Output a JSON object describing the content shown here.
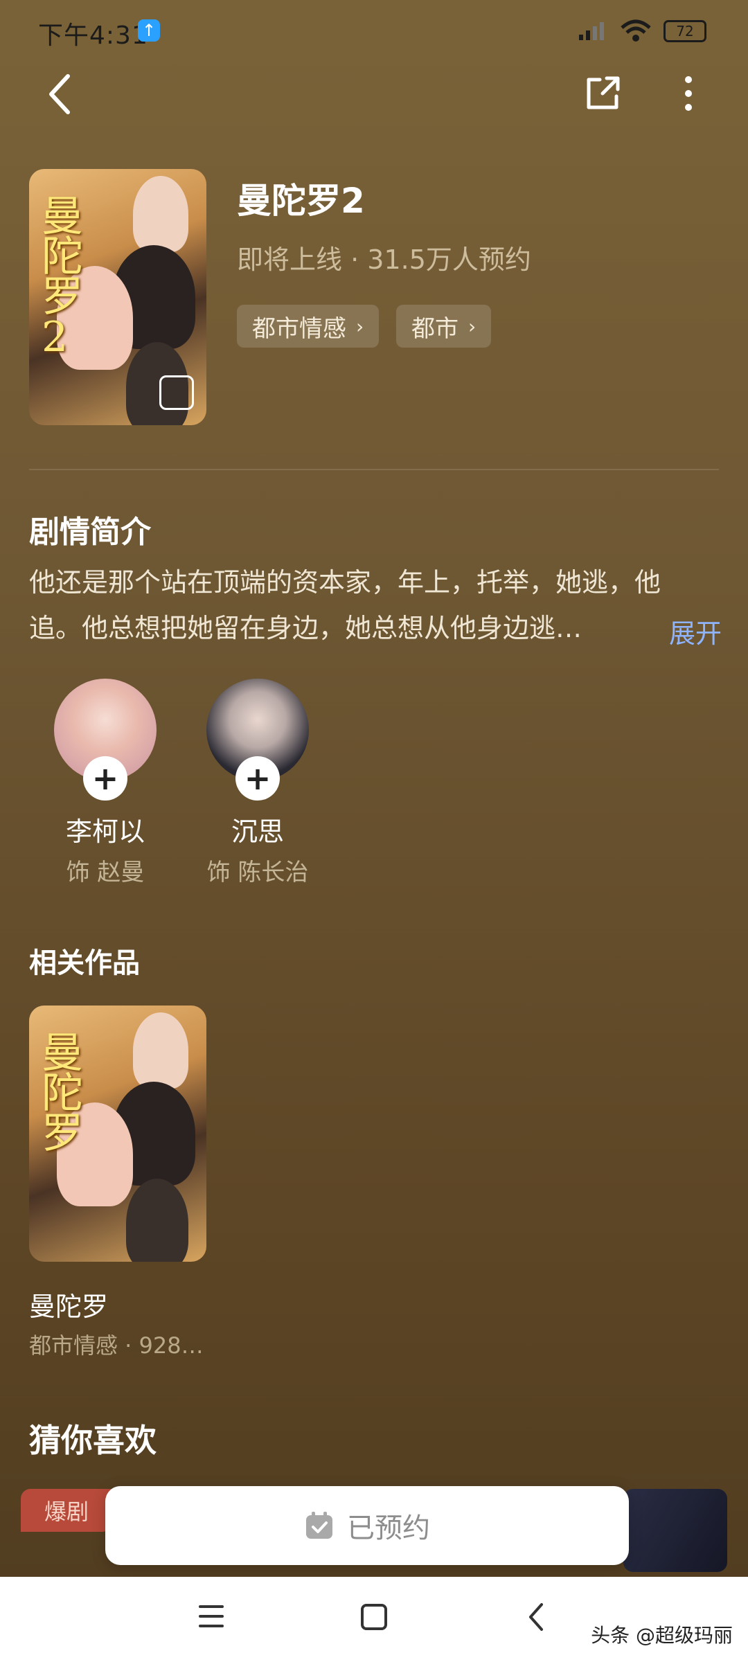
{
  "status_bar": {
    "time": "下午4:31",
    "battery": "72"
  },
  "drama": {
    "title": "曼陀罗2",
    "status": "即将上线",
    "separator": "·",
    "reservations": "31.5万人预约",
    "tags": [
      "都市情感",
      "都市"
    ],
    "cover_text": "曼陀罗2"
  },
  "synopsis": {
    "heading": "剧情简介",
    "text": "他还是那个站在顶端的资本家，年上，托举，她逃，他追。他总想把她留在身边，她总想从他身边逃…",
    "expand_label": "展开"
  },
  "cast": [
    {
      "name": "李柯以",
      "role": "饰 赵曼"
    },
    {
      "name": "沉思",
      "role": "饰 陈长治"
    }
  ],
  "related": {
    "heading": "相关作品",
    "items": [
      {
        "title": "曼陀罗",
        "meta": "都市情感 · 928…",
        "cover_text": "曼陀罗"
      }
    ]
  },
  "recommend": {
    "heading": "猜你喜欢",
    "badge": "爆剧"
  },
  "reserve_button": {
    "label": "已预约"
  },
  "watermark": "头条 @超级玛丽",
  "colors": {
    "accent_blue": "#8fb4ff",
    "background": "#6e5733"
  }
}
